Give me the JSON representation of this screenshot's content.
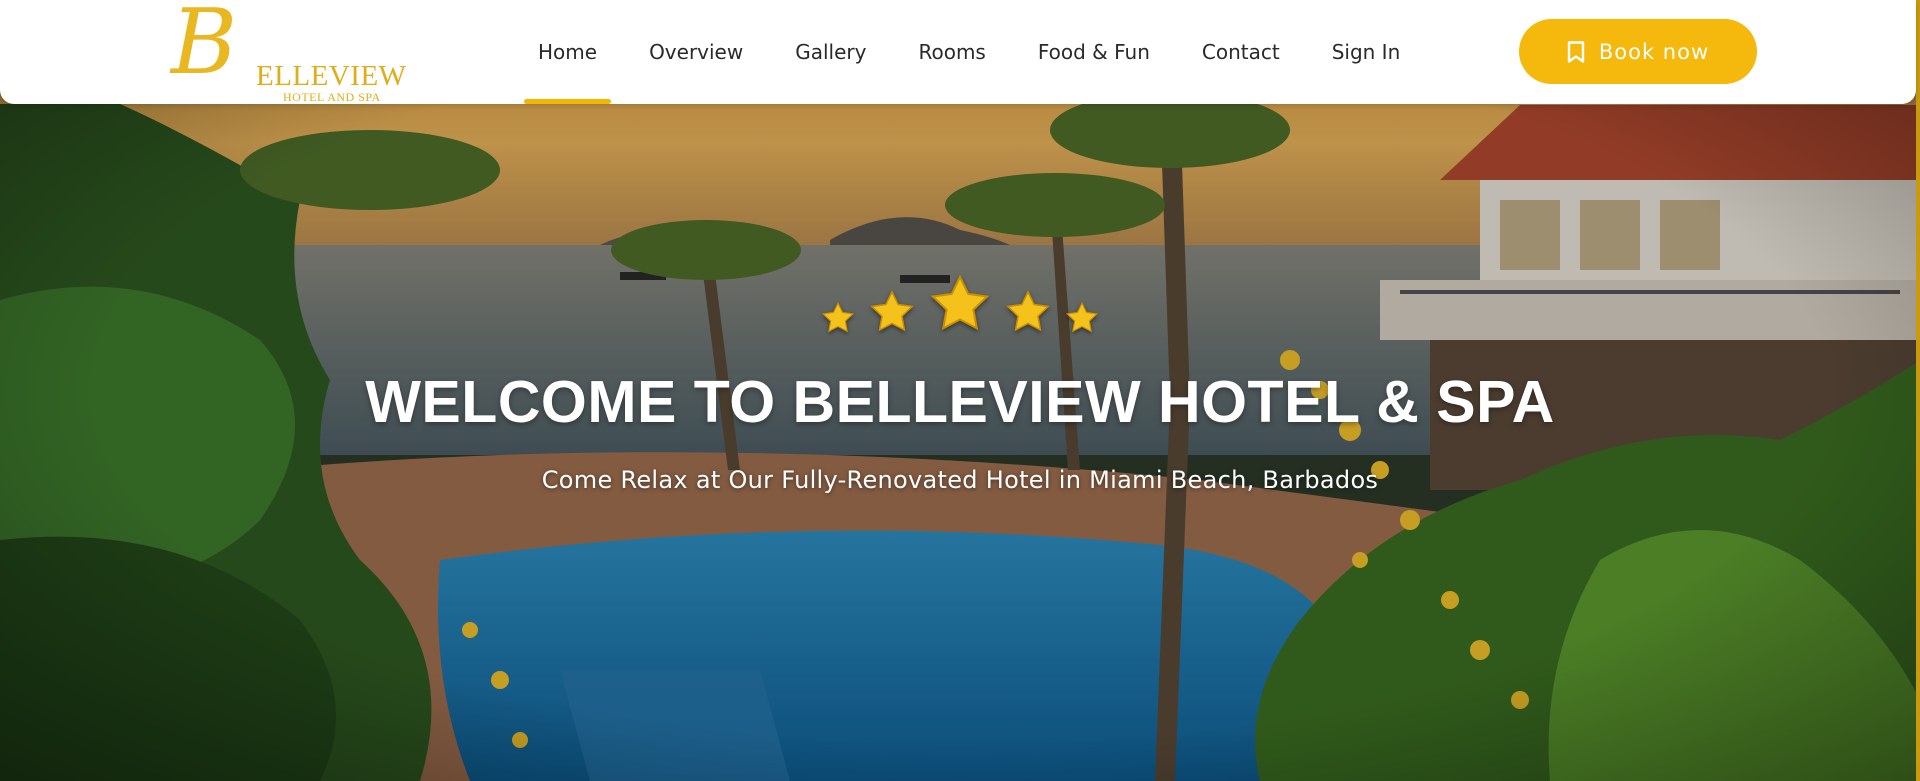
{
  "brand": {
    "logo_letter": "B",
    "logo_name": "ELLEVIEW",
    "logo_tagline": "HOTEL AND SPA"
  },
  "nav": {
    "items": [
      {
        "label": "Home",
        "active": true
      },
      {
        "label": "Overview",
        "active": false
      },
      {
        "label": "Gallery",
        "active": false
      },
      {
        "label": "Rooms",
        "active": false
      },
      {
        "label": "Food & Fun",
        "active": false
      },
      {
        "label": "Contact",
        "active": false
      },
      {
        "label": "Sign In",
        "active": false
      }
    ],
    "cta_label": "Book now",
    "cta_icon": "bookmark-icon"
  },
  "hero": {
    "star_rating": 5,
    "title": "WELCOME TO BELLEVIEW HOTEL & SPA",
    "subtitle": "Come Relax at Our Fully-Renovated Hotel in Miami Beach, Barbados"
  },
  "colors": {
    "accent": "#f5b80c",
    "nav_text": "#2a2a2a",
    "logo_gold": "#e0ad18"
  }
}
